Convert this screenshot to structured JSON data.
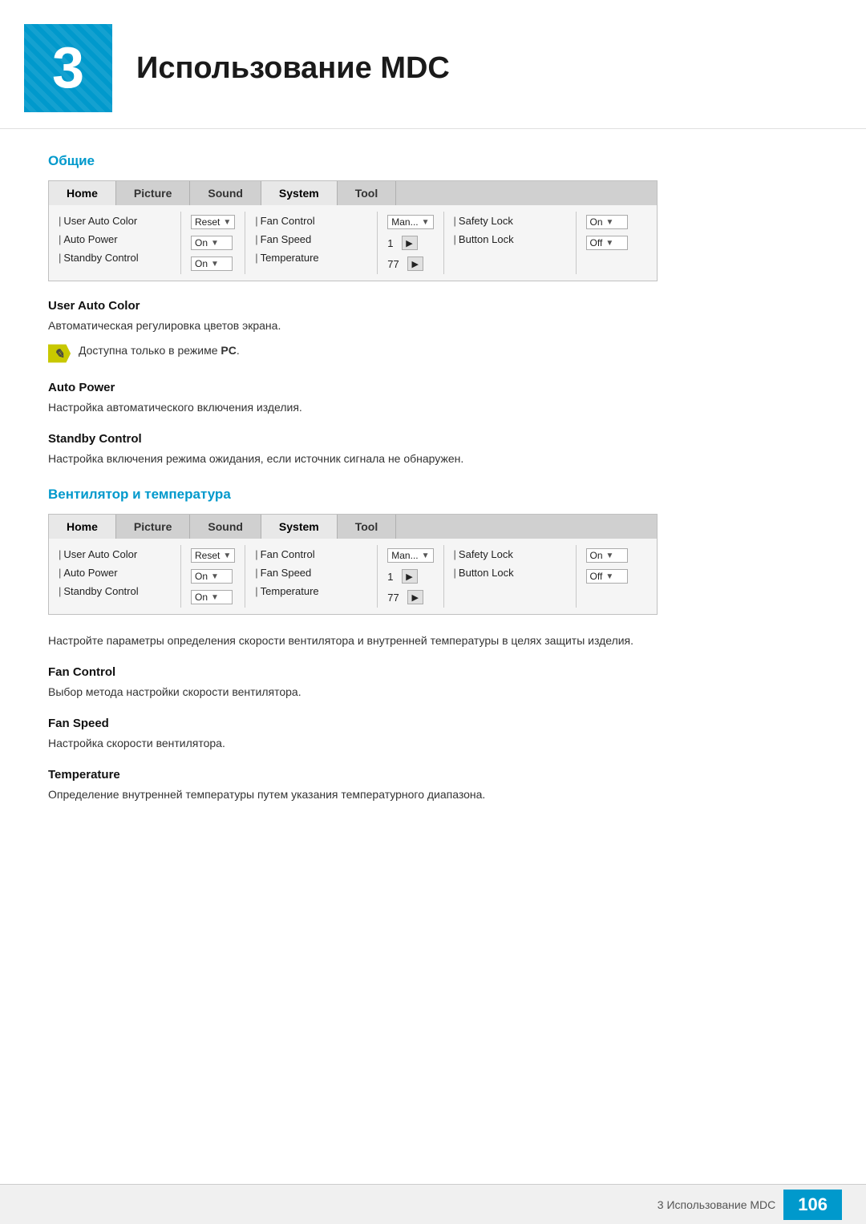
{
  "chapter": {
    "number": "3",
    "title": "Использование MDC"
  },
  "sections": [
    {
      "id": "general",
      "title": "Общие",
      "table": {
        "tabs": [
          "Home",
          "Picture",
          "Sound",
          "System",
          "Tool"
        ],
        "active_tab": "System",
        "columns": [
          {
            "rows": [
              {
                "label": "User Auto Color",
                "control_type": "none"
              },
              {
                "label": "Auto Power",
                "control_type": "none"
              },
              {
                "label": "Standby Control",
                "control_type": "none"
              }
            ]
          },
          {
            "rows": [
              {
                "label": "Reset",
                "value": "Reset",
                "control_type": "dropdown"
              },
              {
                "label": "On",
                "value": "On",
                "control_type": "dropdown"
              },
              {
                "label": "On",
                "value": "On",
                "control_type": "dropdown"
              }
            ]
          },
          {
            "rows": [
              {
                "label": "Fan Control",
                "control_type": "none"
              },
              {
                "label": "Fan Speed",
                "control_type": "none"
              },
              {
                "label": "Temperature",
                "control_type": "none"
              }
            ]
          },
          {
            "rows": [
              {
                "label": "Man...",
                "value": "Man...",
                "control_type": "dropdown"
              },
              {
                "label": "1",
                "value": "1",
                "control_type": "arrow"
              },
              {
                "label": "77",
                "value": "77",
                "control_type": "arrow"
              }
            ]
          },
          {
            "rows": [
              {
                "label": "Safety Lock",
                "control_type": "none"
              },
              {
                "label": "Button Lock",
                "control_type": "none"
              }
            ]
          },
          {
            "rows": [
              {
                "label": "On",
                "value": "On",
                "control_type": "dropdown"
              },
              {
                "label": "Off",
                "value": "Off",
                "control_type": "dropdown"
              }
            ]
          }
        ]
      },
      "subsections": [
        {
          "id": "user-auto-color",
          "heading": "User Auto Color",
          "text": "Автоматическая регулировка цветов экрана.",
          "note": "Доступна только в режиме PC."
        },
        {
          "id": "auto-power",
          "heading": "Auto Power",
          "text": "Настройка автоматического включения изделия.",
          "note": null
        },
        {
          "id": "standby-control",
          "heading": "Standby Control",
          "text": "Настройка включения режима ожидания, если источник сигнала не обнаружен.",
          "note": null
        }
      ]
    },
    {
      "id": "fan-temp",
      "title": "Вентилятор и температура",
      "table": {
        "tabs": [
          "Home",
          "Picture",
          "Sound",
          "System",
          "Tool"
        ],
        "active_tab": "System",
        "columns": [
          {
            "rows": [
              {
                "label": "User Auto Color",
                "control_type": "none"
              },
              {
                "label": "Auto Power",
                "control_type": "none"
              },
              {
                "label": "Standby Control",
                "control_type": "none"
              }
            ]
          },
          {
            "rows": [
              {
                "label": "Reset",
                "value": "Reset",
                "control_type": "dropdown"
              },
              {
                "label": "On",
                "value": "On",
                "control_type": "dropdown"
              },
              {
                "label": "On",
                "value": "On",
                "control_type": "dropdown"
              }
            ]
          },
          {
            "rows": [
              {
                "label": "Fan Control",
                "control_type": "none"
              },
              {
                "label": "Fan Speed",
                "control_type": "none"
              },
              {
                "label": "Temperature",
                "control_type": "none"
              }
            ]
          },
          {
            "rows": [
              {
                "label": "Man...",
                "value": "Man...",
                "control_type": "dropdown"
              },
              {
                "label": "1",
                "value": "1",
                "control_type": "arrow"
              },
              {
                "label": "77",
                "value": "77",
                "control_type": "arrow"
              }
            ]
          },
          {
            "rows": [
              {
                "label": "Safety Lock",
                "control_type": "none"
              },
              {
                "label": "Button Lock",
                "control_type": "none"
              }
            ]
          },
          {
            "rows": [
              {
                "label": "On",
                "value": "On",
                "control_type": "dropdown"
              },
              {
                "label": "Off",
                "value": "Off",
                "control_type": "dropdown"
              }
            ]
          }
        ]
      },
      "intro_text": "Настройте параметры определения скорости вентилятора и внутренней температуры в целях защиты изделия.",
      "subsections": [
        {
          "id": "fan-control",
          "heading": "Fan Control",
          "text": "Выбор метода настройки скорости вентилятора.",
          "note": null
        },
        {
          "id": "fan-speed",
          "heading": "Fan Speed",
          "text": "Настройка скорости вентилятора.",
          "note": null
        },
        {
          "id": "temperature",
          "heading": "Temperature",
          "text": "Определение внутренней температуры путем указания температурного диапазона.",
          "note": null
        }
      ]
    }
  ],
  "footer": {
    "text": "3 Использование MDC",
    "page": "106"
  },
  "note_pc_text": "Доступна только в режиме ",
  "note_pc_bold": "PC",
  "note_pc_suffix": "."
}
